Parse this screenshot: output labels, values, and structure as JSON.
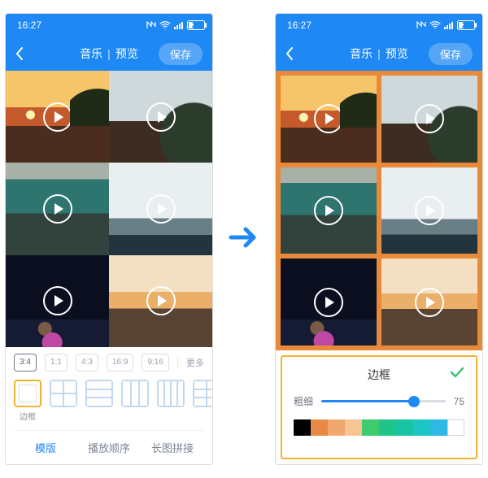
{
  "status": {
    "time": "16:27",
    "battery": "29"
  },
  "header": {
    "music": "音乐",
    "preview": "预览",
    "save": "保存"
  },
  "panel1": {
    "ratios": [
      "3:4",
      "1:1",
      "4:3",
      "16:9",
      "9:16"
    ],
    "ratio_selected_index": 0,
    "more": "更多",
    "layout_border_label": "边框",
    "tabs": [
      "模版",
      "播放顺序",
      "长图拼接"
    ],
    "active_tab_index": 0
  },
  "panel2": {
    "title": "边框",
    "thickness_label": "粗细",
    "thickness_value": "75",
    "colors": [
      "#000000",
      "#e88a46",
      "#f0a86e",
      "#f6c591",
      "#3ecb70",
      "#1fc489",
      "#18c4a3",
      "#1bc5c4",
      "#2db9e3",
      "#ffffff"
    ]
  }
}
